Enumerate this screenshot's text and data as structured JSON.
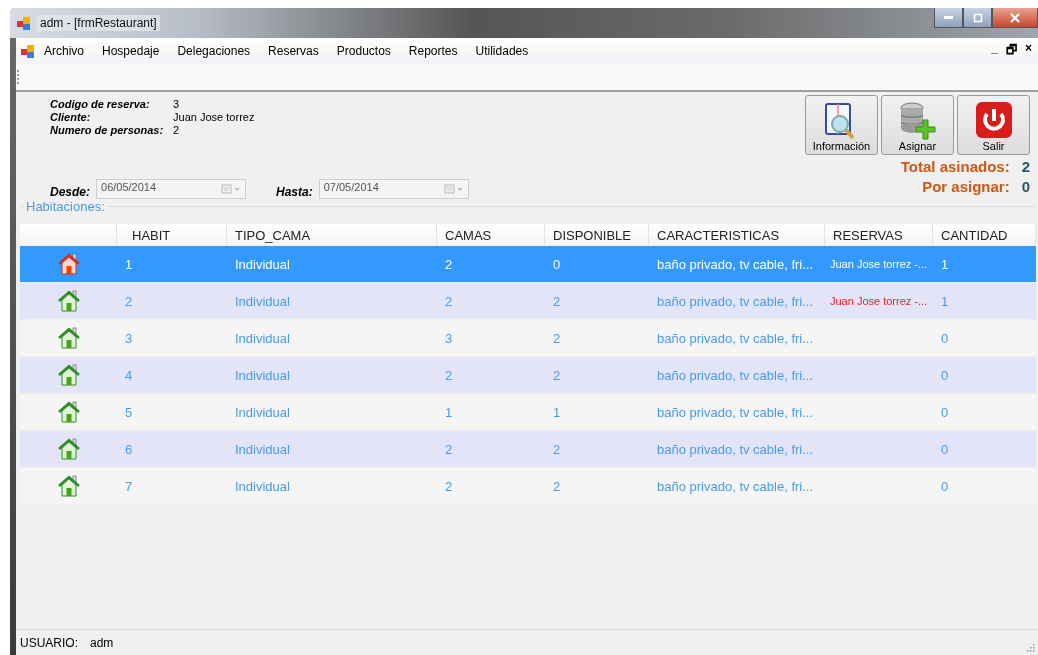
{
  "window": {
    "title": "adm - [frmRestaurant]"
  },
  "menu": [
    "Archivo",
    "Hospedaje",
    "Delegaciones",
    "Reservas",
    "Productos",
    "Reportes",
    "Utilidades"
  ],
  "mdi_controls": [
    "_",
    "🗗",
    "×"
  ],
  "info": [
    {
      "label": "Codigo de reserva:",
      "value": "3"
    },
    {
      "label": "Cliente:",
      "value": "Juan Jose torrez"
    },
    {
      "label": "Numero de personas:",
      "value": "2"
    }
  ],
  "dates": [
    {
      "label": "Desde:",
      "value": "06/05/2014"
    },
    {
      "label": "Hasta:",
      "value": "07/05/2014"
    }
  ],
  "buttons": [
    {
      "kind": "info",
      "label": "Información"
    },
    {
      "kind": "assign",
      "label": "Asignar"
    },
    {
      "kind": "exit",
      "label": "Salir"
    }
  ],
  "totals": [
    {
      "label": "Total asinados:",
      "value": "2"
    },
    {
      "label": "Por asignar:",
      "value": "0"
    }
  ],
  "group": {
    "title": "Habitaciones:"
  },
  "table": {
    "columns": [
      "HABIT",
      "TIPO_CAMA",
      "CAMAS",
      "DISPONIBLE",
      "CARACTERISTICAS",
      "RESERVAS",
      "CANTIDAD"
    ],
    "rows": [
      {
        "occupied": true,
        "selected": true,
        "cells": [
          "1",
          "Individual",
          "2",
          "0",
          "baño privado, tv cable, fri...",
          "Juan Jose torrez -...",
          "1"
        ]
      },
      {
        "occupied": false,
        "selected": false,
        "cells": [
          "2",
          "Individual",
          "2",
          "2",
          "baño privado, tv cable, fri...",
          "Juan Jose torrez -...",
          "1"
        ]
      },
      {
        "occupied": false,
        "selected": false,
        "cells": [
          "3",
          "Individual",
          "3",
          "2",
          "baño privado, tv cable, fri...",
          "",
          "0"
        ]
      },
      {
        "occupied": false,
        "selected": false,
        "cells": [
          "4",
          "Individual",
          "2",
          "2",
          "baño privado, tv cable, fri...",
          "",
          "0"
        ]
      },
      {
        "occupied": false,
        "selected": false,
        "cells": [
          "5",
          "Individual",
          "1",
          "1",
          "baño privado, tv cable, fri...",
          "",
          "0"
        ]
      },
      {
        "occupied": false,
        "selected": false,
        "cells": [
          "6",
          "Individual",
          "2",
          "2",
          "baño privado, tv cable, fri...",
          "",
          "0"
        ]
      },
      {
        "occupied": false,
        "selected": false,
        "cells": [
          "7",
          "Individual",
          "2",
          "2",
          "baño privado, tv cable, fri...",
          "",
          "0"
        ]
      }
    ]
  },
  "status_bar": {
    "label": "USUARIO:",
    "value": "adm"
  }
}
